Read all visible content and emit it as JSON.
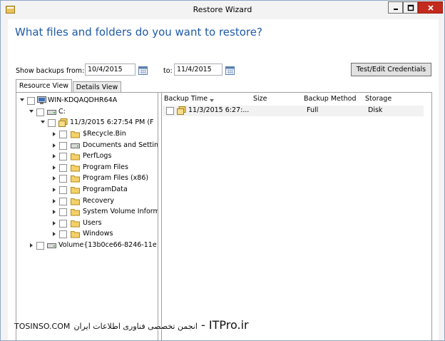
{
  "window": {
    "title": "Restore Wizard",
    "close_color": "#c42b1c",
    "heading_color": "#1e5aa8"
  },
  "heading": "What files and folders do you want to restore?",
  "filter": {
    "from_label": "Show backups from:",
    "from_value": "10/4/2015",
    "to_label": "to:",
    "to_value": "11/4/2015",
    "credentials_button": "Test/Edit Credentials"
  },
  "tabs": [
    {
      "label": "Resource View",
      "selected": true
    },
    {
      "label": "Details View",
      "selected": false
    }
  ],
  "tree": {
    "root": {
      "label": "WIN-KDQAQDHR64A",
      "icon": "computer-icon"
    },
    "drive": {
      "label": "C:",
      "icon": "drive-icon"
    },
    "backup": {
      "label": "11/3/2015 6:27:54 PM (F",
      "icon": "backup-icon"
    },
    "folders": [
      {
        "label": "$Recycle.Bin",
        "icon": "folder-icon"
      },
      {
        "label": "Documents and Settin",
        "icon": "drive-icon"
      },
      {
        "label": "PerfLogs",
        "icon": "folder-icon"
      },
      {
        "label": "Program Files",
        "icon": "folder-icon"
      },
      {
        "label": "Program Files (x86)",
        "icon": "folder-icon"
      },
      {
        "label": "ProgramData",
        "icon": "folder-icon"
      },
      {
        "label": "Recovery",
        "icon": "folder-icon"
      },
      {
        "label": "System Volume Inform",
        "icon": "folder-icon"
      },
      {
        "label": "Users",
        "icon": "folder-icon"
      },
      {
        "label": "Windows",
        "icon": "folder-icon"
      }
    ],
    "volume": {
      "label": "Volume{13b0ce66-8246-11e",
      "icon": "drive-icon"
    }
  },
  "list": {
    "columns": [
      "Backup Time",
      "Size",
      "Backup Method",
      "Storage"
    ],
    "rows": [
      {
        "backup_time": "11/3/2015 6:27:...",
        "size": "",
        "method": "Full",
        "storage": "Disk"
      }
    ]
  },
  "watermark": {
    "latin": "TOSINSO.COM",
    "arabic": "انجمن تخصصی فناوری اطلاعات ایران",
    "site": "ITPro.ir",
    "dash": "-"
  }
}
